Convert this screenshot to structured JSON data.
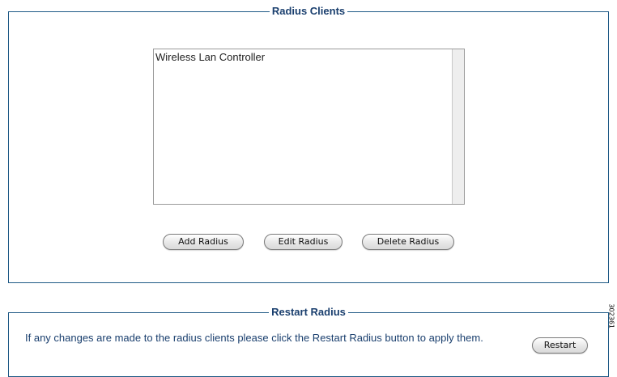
{
  "radius_clients": {
    "legend": "Radius Clients",
    "list_items": [
      "Wireless Lan Controller"
    ],
    "add_label": "Add Radius",
    "edit_label": "Edit Radius",
    "delete_label": "Delete Radius"
  },
  "restart_radius": {
    "legend": "Restart Radius",
    "message": "If any changes are made to the radius clients please click the Restart Radius button to apply them.",
    "button_label": "Restart"
  },
  "figure_number": "302361"
}
